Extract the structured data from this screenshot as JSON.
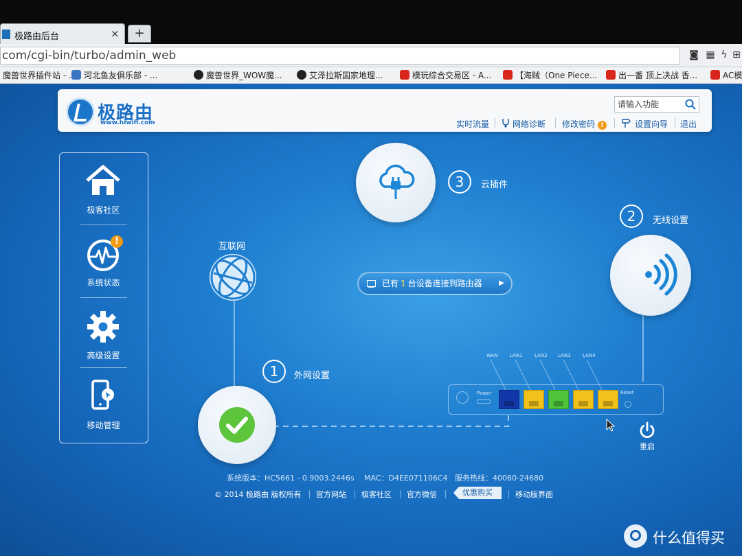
{
  "browser": {
    "tab_title": "极路由后台",
    "tab_close": "×",
    "new_tab": "+",
    "url": "com/cgi-bin/turbo/admin_web",
    "bookmarks": [
      "魔兽世界插件站 - ...",
      "河北鱼友俱乐部 - ...",
      "魔兽世界_WOW魔...",
      "艾泽拉斯国家地理...",
      "模玩综合交易区 - A...",
      "【海贼（One Piece...",
      "出一番 顶上决战 香...",
      "AC模"
    ]
  },
  "header": {
    "brand": "极路由",
    "brand_url": "www.hiwifi.com",
    "search_placeholder": "请输入功能",
    "nav": [
      "实时流量",
      "网络诊断",
      "修改密码",
      "设置向导",
      "退出"
    ],
    "warning_mark": "!"
  },
  "sidebar": {
    "items": [
      {
        "label": "极客社区"
      },
      {
        "label": "系统状态",
        "alert": "!"
      },
      {
        "label": "高级设置"
      },
      {
        "label": "移动管理"
      }
    ]
  },
  "main": {
    "internet_label": "互联网",
    "step1": {
      "num": "1",
      "label": "外网设置"
    },
    "step2": {
      "num": "2",
      "label": "无线设置"
    },
    "step3": {
      "num": "3",
      "label": "云插件"
    },
    "device_pill": {
      "prefix": "已有",
      "count": "1",
      "suffix": "台设备连接到路由器",
      "arrow": "▶"
    },
    "router": {
      "port_labels": [
        "WAN",
        "LAN1",
        "LAN2",
        "LAN3",
        "LAN4"
      ],
      "power_label": "Power",
      "reset_label": "Reset"
    },
    "reboot_label": "重启"
  },
  "footer": {
    "system_version": "系统版本：HC5661 - 0.9003.2446s",
    "mac": "MAC：D4EE071106C4",
    "hotline": "服务热线：40060-24680",
    "copyright": "© 2014 极路由 版权所有",
    "links": [
      "官方网站",
      "极客社区",
      "官方微信"
    ],
    "buy": "优惠购买",
    "mobile": "移动版界面"
  },
  "watermark": {
    "text": "什么值得买"
  },
  "colors": {
    "page_bg": "#1f7ed0",
    "accent": "#1b6fc4",
    "success": "#5cc53c",
    "warning": "#f39a14",
    "port_wan": "#1237a8",
    "port_yellow": "#f2c21b",
    "port_green": "#4fc43a"
  }
}
